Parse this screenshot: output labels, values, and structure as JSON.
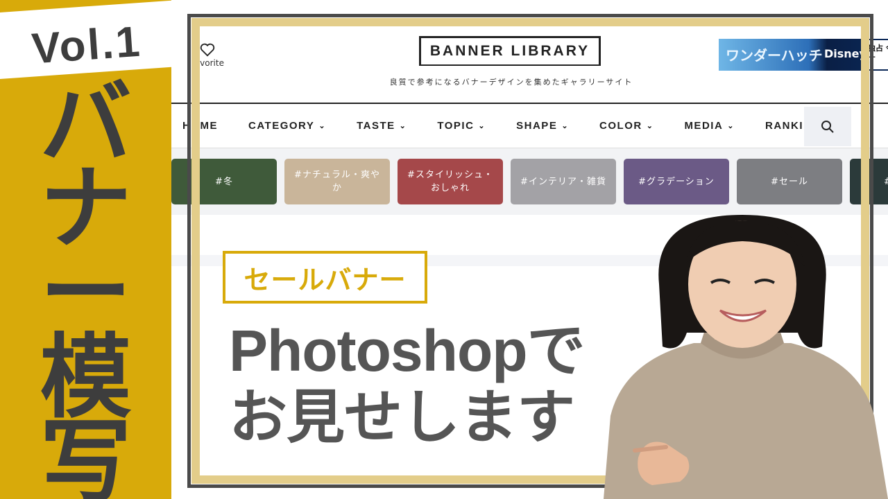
{
  "thumbnail": {
    "vol": "Vol.1",
    "vertical_title": [
      "バ",
      "ナ",
      "ー",
      "模",
      "写"
    ],
    "badge": "セールバナー",
    "headline_line1": "Photoshopで",
    "headline_line2": "お見せします"
  },
  "site": {
    "favorite_label": "Favorite",
    "logo": "BANNER LIBRARY",
    "tagline": "良質で参考になるバナーデザインを集めたギャラリーサイト",
    "ad": {
      "title": "ワンダーハッチ",
      "brand": "Disney+",
      "side": "独占 今す"
    },
    "nav": [
      {
        "label": "HOME",
        "dropdown": false
      },
      {
        "label": "CATEGORY",
        "dropdown": true
      },
      {
        "label": "TASTE",
        "dropdown": true
      },
      {
        "label": "TOPIC",
        "dropdown": true
      },
      {
        "label": "SHAPE",
        "dropdown": true
      },
      {
        "label": "COLOR",
        "dropdown": true
      },
      {
        "label": "MEDIA",
        "dropdown": true
      },
      {
        "label": "RANKING",
        "dropdown": false
      }
    ],
    "tags": [
      {
        "label": "#冬",
        "color": "#3f5a3a"
      },
      {
        "label": "#ナチュラル・爽やか",
        "color": "#c9b59a"
      },
      {
        "label": "#スタイリッシュ・おしゃれ",
        "color": "#a5484a"
      },
      {
        "label": "#インテリア・雑貨",
        "color": "#a3a2a6"
      },
      {
        "label": "#グラデーション",
        "color": "#6b5a86"
      },
      {
        "label": "#セール",
        "color": "#7d7e82"
      },
      {
        "label": "#文字組",
        "color": "#2b3a3a"
      }
    ]
  },
  "colors": {
    "accent_gold": "#d8aa0a",
    "frame_beige": "#e3cd8a",
    "text_gray": "#555555",
    "dark": "#3d3d3d"
  }
}
